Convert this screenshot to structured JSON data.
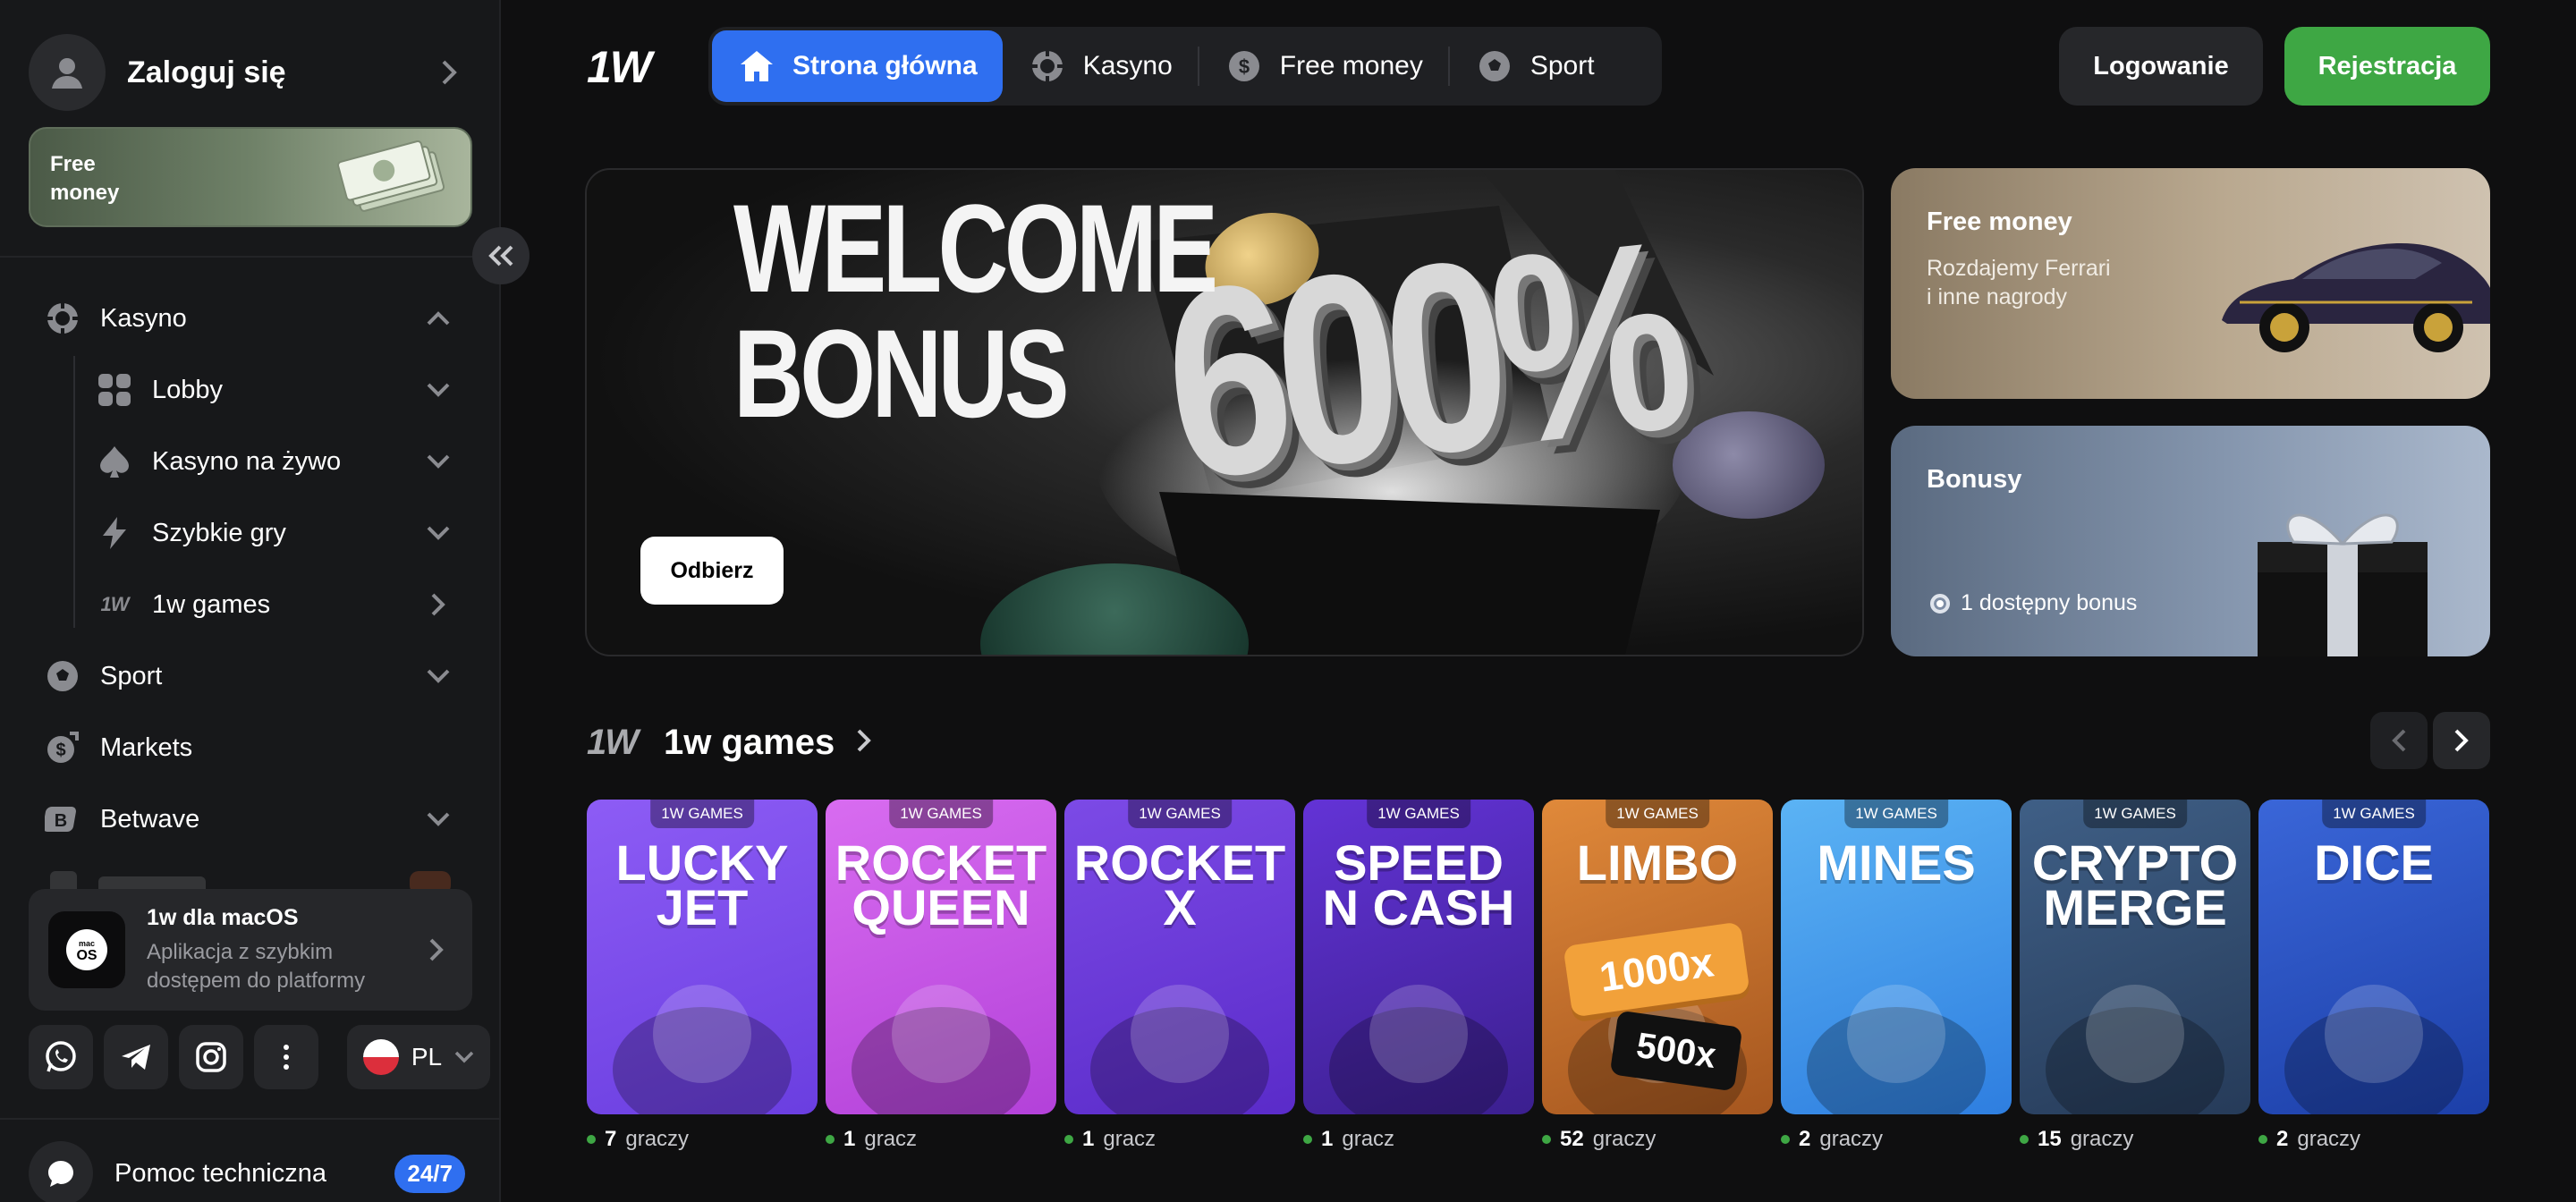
{
  "sidebar": {
    "login_label": "Zaloguj się",
    "free_money_label": "Free money",
    "nav": [
      {
        "label": "Kasyno",
        "icon": "casino-chip-icon",
        "state": "expanded"
      },
      {
        "label": "Lobby",
        "icon": "grid-icon",
        "state": "collapsed"
      },
      {
        "label": "Kasyno na żywo",
        "icon": "spade-icon",
        "state": "collapsed"
      },
      {
        "label": "Szybkie gry",
        "icon": "lightning-icon",
        "state": "collapsed"
      },
      {
        "label": "1w games",
        "icon": "1w-logo-icon",
        "state": "link"
      },
      {
        "label": "Sport",
        "icon": "football-icon",
        "state": "collapsed"
      },
      {
        "label": "Markets",
        "icon": "markets-icon",
        "state": "none"
      },
      {
        "label": "Betwave",
        "icon": "betwave-icon",
        "state": "collapsed"
      }
    ],
    "mac_app": {
      "logo_line1": "mac",
      "logo_line2": "OS",
      "title": "1w dla macOS",
      "description": "Aplikacja z szybkim dostępem do platformy"
    },
    "language": "PL",
    "support_label": "Pomoc techniczna",
    "support_badge": "24/7"
  },
  "header": {
    "logo": "1W",
    "tabs": [
      {
        "label": "Strona główna",
        "icon": "home-icon",
        "active": true
      },
      {
        "label": "Kasyno",
        "icon": "casino-chip-icon",
        "active": false
      },
      {
        "label": "Free money",
        "icon": "dollar-coin-icon",
        "active": false
      },
      {
        "label": "Sport",
        "icon": "football-icon",
        "active": false
      }
    ],
    "login_button": "Logowanie",
    "register_button": "Rejestracja"
  },
  "hero": {
    "title_line1": "WELCOME",
    "title_line2": "BONUS",
    "percent": "600%",
    "claim_button": "Odbierz"
  },
  "promos": {
    "free_money": {
      "title": "Free money",
      "line1": "Rozdajemy Ferrari",
      "line2": "i inne nagrody"
    },
    "bonuses": {
      "title": "Bonusy",
      "count_text": "1 dostępny bonus"
    }
  },
  "games_section": {
    "logo": "1W",
    "title": "1w games",
    "tag": "1W GAMES",
    "games": [
      {
        "title_line1": "LUCKY",
        "title_line2": "JET",
        "players_count": "7",
        "players_word": "graczy",
        "colors": [
          "#6a3ee0",
          "#8d5cf5"
        ]
      },
      {
        "title_line1": "ROCKET",
        "title_line2": "QUEEN",
        "players_count": "1",
        "players_word": "gracz",
        "colors": [
          "#b341d9",
          "#d86cf0"
        ]
      },
      {
        "title_line1": "ROCKET",
        "title_line2": "X",
        "players_count": "1",
        "players_word": "gracz",
        "colors": [
          "#5a2bc9",
          "#7c4ae6"
        ]
      },
      {
        "title_line1": "SPEED",
        "title_line2": "N CASH",
        "players_count": "1",
        "players_word": "gracz",
        "colors": [
          "#3b1f8f",
          "#6333d6"
        ]
      },
      {
        "title_line1": "LIMBO",
        "title_line2": "",
        "players_count": "52",
        "players_word": "graczy",
        "colors": [
          "#a5561f",
          "#e0893a"
        ]
      },
      {
        "title_line1": "MINES",
        "title_line2": "",
        "players_count": "2",
        "players_word": "graczy",
        "colors": [
          "#2e7ee0",
          "#5bb3f4"
        ]
      },
      {
        "title_line1": "CRYPTO",
        "title_line2": "MERGE",
        "players_count": "15",
        "players_word": "graczy",
        "colors": [
          "#263b59",
          "#3f5f86"
        ]
      },
      {
        "title_line1": "DICE",
        "title_line2": "",
        "players_count": "2",
        "players_word": "graczy",
        "colors": [
          "#1c3fa8",
          "#3a66d8"
        ]
      }
    ],
    "limbo_chips": [
      "1000x",
      "500x"
    ]
  },
  "colors": {
    "accent_blue": "#2f6ff0",
    "register_green": "#3ea744",
    "online_dot": "#3ea744"
  }
}
